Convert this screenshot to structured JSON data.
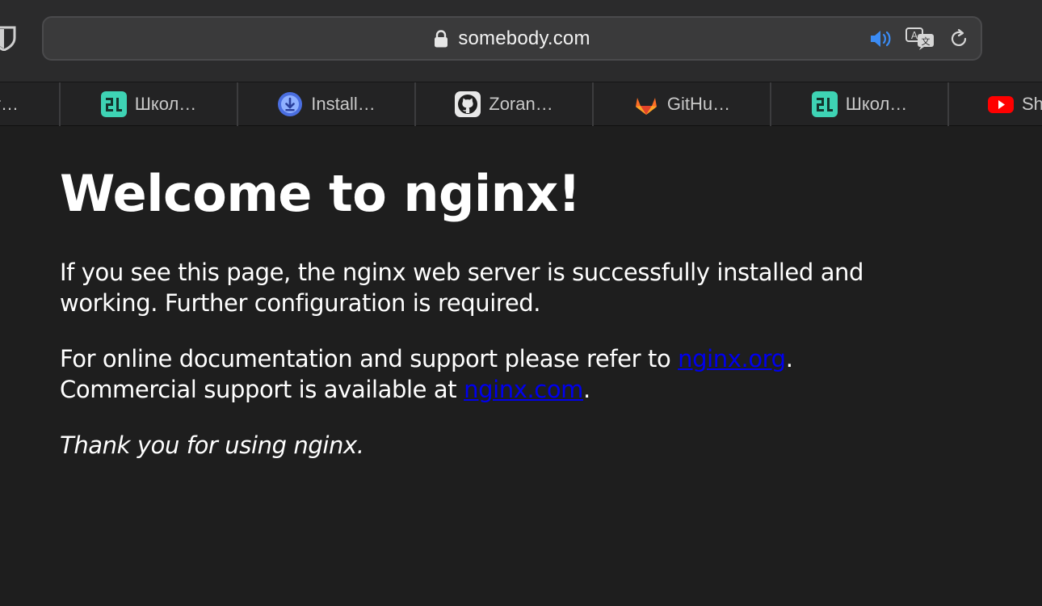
{
  "browser": {
    "url": "somebody.com",
    "tabs": [
      {
        "label": "…r…",
        "icon": "partial-tab"
      },
      {
        "label": "Школ…",
        "icon": "school21-icon"
      },
      {
        "label": "Install…",
        "icon": "download-icon"
      },
      {
        "label": "Zoran…",
        "icon": "github-icon"
      },
      {
        "label": "GitHu…",
        "icon": "gitlab-icon"
      },
      {
        "label": "Школ…",
        "icon": "school21-icon"
      },
      {
        "label": "Sh",
        "icon": "youtube-icon"
      }
    ]
  },
  "page": {
    "heading": "Welcome to nginx!",
    "para1": "If you see this page, the nginx web server is successfully installed and working. Further configuration is required.",
    "para2_prefix": "For online documentation and support please refer to ",
    "link_org": "nginx.org",
    "para2_mid": ".",
    "para2_line2": "Commercial support is available at ",
    "link_com": "nginx.com",
    "para2_end": ".",
    "thanks": "Thank you for using nginx."
  },
  "colors": {
    "background": "#1e1e1e",
    "link": "#0000ee",
    "toolbar": "#2b2b2c",
    "accent_audio": "#3b8cf5"
  }
}
